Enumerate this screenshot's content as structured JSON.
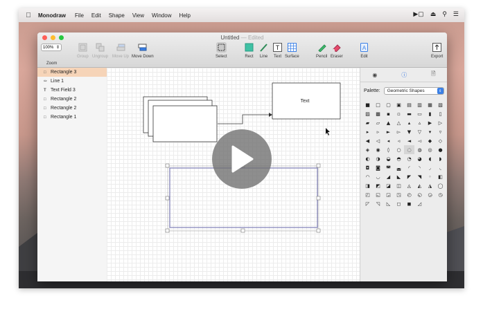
{
  "menubar": {
    "app_name": "Monodraw",
    "items": [
      "File",
      "Edit",
      "Shape",
      "View",
      "Window",
      "Help"
    ]
  },
  "window": {
    "title": "Untitled",
    "edited": "— Edited"
  },
  "toolbar": {
    "zoom_value": "100%",
    "zoom_label": "Zoom",
    "group": "Group",
    "ungroup": "Ungroup",
    "move_up": "Move Up",
    "move_down": "Move Down",
    "select": "Select",
    "rect": "Rect",
    "line": "Line",
    "text": "Text",
    "surface": "Surface",
    "pencil": "Pencil",
    "eraser": "Eraser",
    "edit": "Edit",
    "export": "Export"
  },
  "layers": [
    {
      "label": "Rectangle 3",
      "icon": "rectangle-icon",
      "selected": true
    },
    {
      "label": "Line 1",
      "icon": "line-icon",
      "selected": false
    },
    {
      "label": "Text Field 3",
      "icon": "text-icon",
      "selected": false
    },
    {
      "label": "Rectangle 2",
      "icon": "rectangle-icon",
      "selected": false
    },
    {
      "label": "Rectangle 2",
      "icon": "rectangle-icon",
      "selected": false
    },
    {
      "label": "Rectangle 1",
      "icon": "rectangle-icon",
      "selected": false
    }
  ],
  "canvas": {
    "text_box_label": "Text"
  },
  "palette": {
    "label": "Palette:",
    "selected": "Geometric Shapes",
    "glyphs": [
      "■",
      "□",
      "▢",
      "▣",
      "▤",
      "▥",
      "▦",
      "▧",
      "▨",
      "▩",
      "▪",
      "▫",
      "▬",
      "▭",
      "▮",
      "▯",
      "▰",
      "▱",
      "▲",
      "△",
      "▴",
      "▵",
      "▶",
      "▷",
      "▸",
      "▹",
      "►",
      "▻",
      "▼",
      "▽",
      "▾",
      "▿",
      "◀",
      "◁",
      "◂",
      "◃",
      "◄",
      "◅",
      "◆",
      "◇",
      "◈",
      "◉",
      "◊",
      "○",
      "◌",
      "◍",
      "◎",
      "●",
      "◐",
      "◑",
      "◒",
      "◓",
      "◔",
      "◕",
      "◖",
      "◗",
      "◘",
      "◙",
      "◚",
      "◛",
      "◜",
      "◝",
      "◞",
      "◟",
      "◠",
      "◡",
      "◢",
      "◣",
      "◤",
      "◥",
      "◦",
      "◧",
      "◨",
      "◩",
      "◪",
      "◫",
      "◬",
      "◭",
      "◮",
      "◯",
      "◰",
      "◱",
      "◲",
      "◳",
      "◴",
      "◵",
      "◶",
      "◷",
      "◸",
      "◹",
      "◺",
      "◻",
      "◼",
      "◿"
    ],
    "highlighted_index": 44
  },
  "colors": {
    "selection_highlight": "#f6d4b8",
    "accent_blue": "#3b80e6",
    "rect_tool_teal": "#3fc1a4",
    "close": "#ff5f57",
    "minimize": "#febc2e",
    "zoom": "#28c840"
  }
}
